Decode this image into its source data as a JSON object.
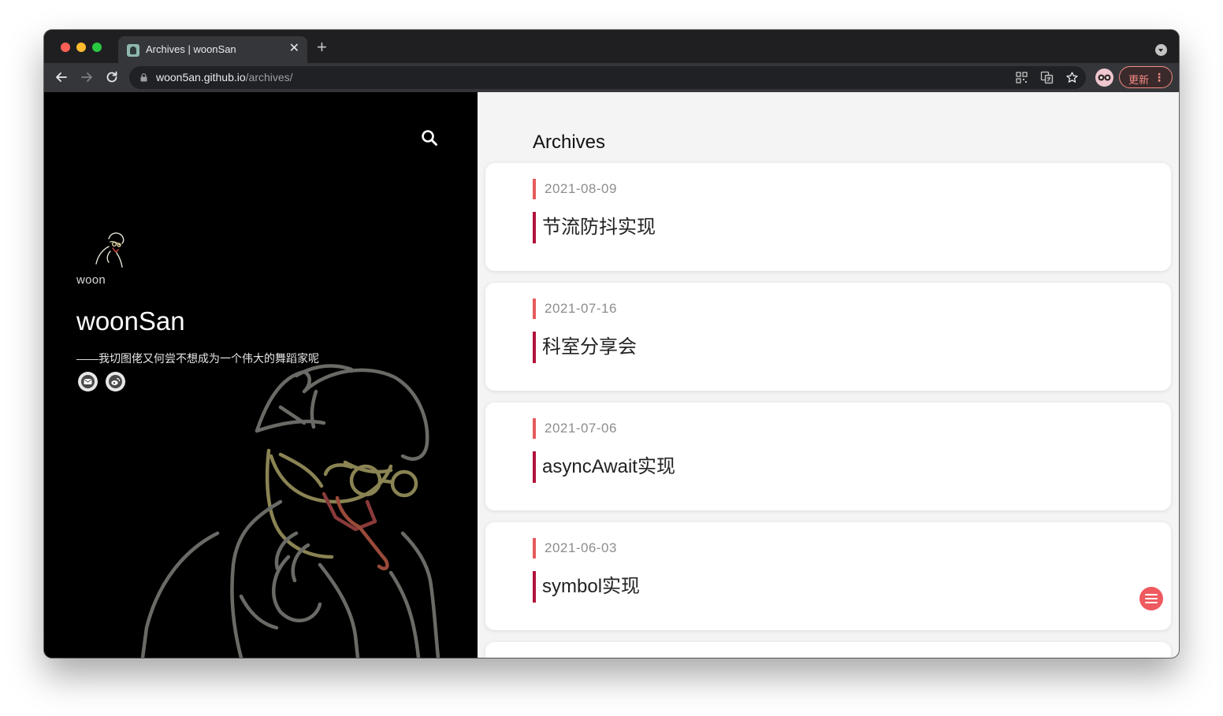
{
  "browser": {
    "tab_title": "Archives | woonSan",
    "url_host": "woon5an.github.io",
    "url_path": "/archives/",
    "update_label": "更新"
  },
  "sidebar": {
    "avatar_caption": "woon",
    "site_title": "woonSan",
    "subtitle": "——我切图佬又何尝不想成为一个伟大的舞蹈家呢",
    "social_links": [
      "email",
      "weibo"
    ]
  },
  "main": {
    "heading": "Archives",
    "posts": [
      {
        "date": "2021-08-09",
        "title": "节流防抖实现"
      },
      {
        "date": "2021-07-16",
        "title": "科室分享会"
      },
      {
        "date": "2021-07-06",
        "title": "asyncAwait实现"
      },
      {
        "date": "2021-06-03",
        "title": "symbol实现"
      }
    ]
  },
  "colors": {
    "accent_date": "#e65b5b",
    "accent_title": "#b0133d",
    "fab": "#ee5a5f"
  }
}
